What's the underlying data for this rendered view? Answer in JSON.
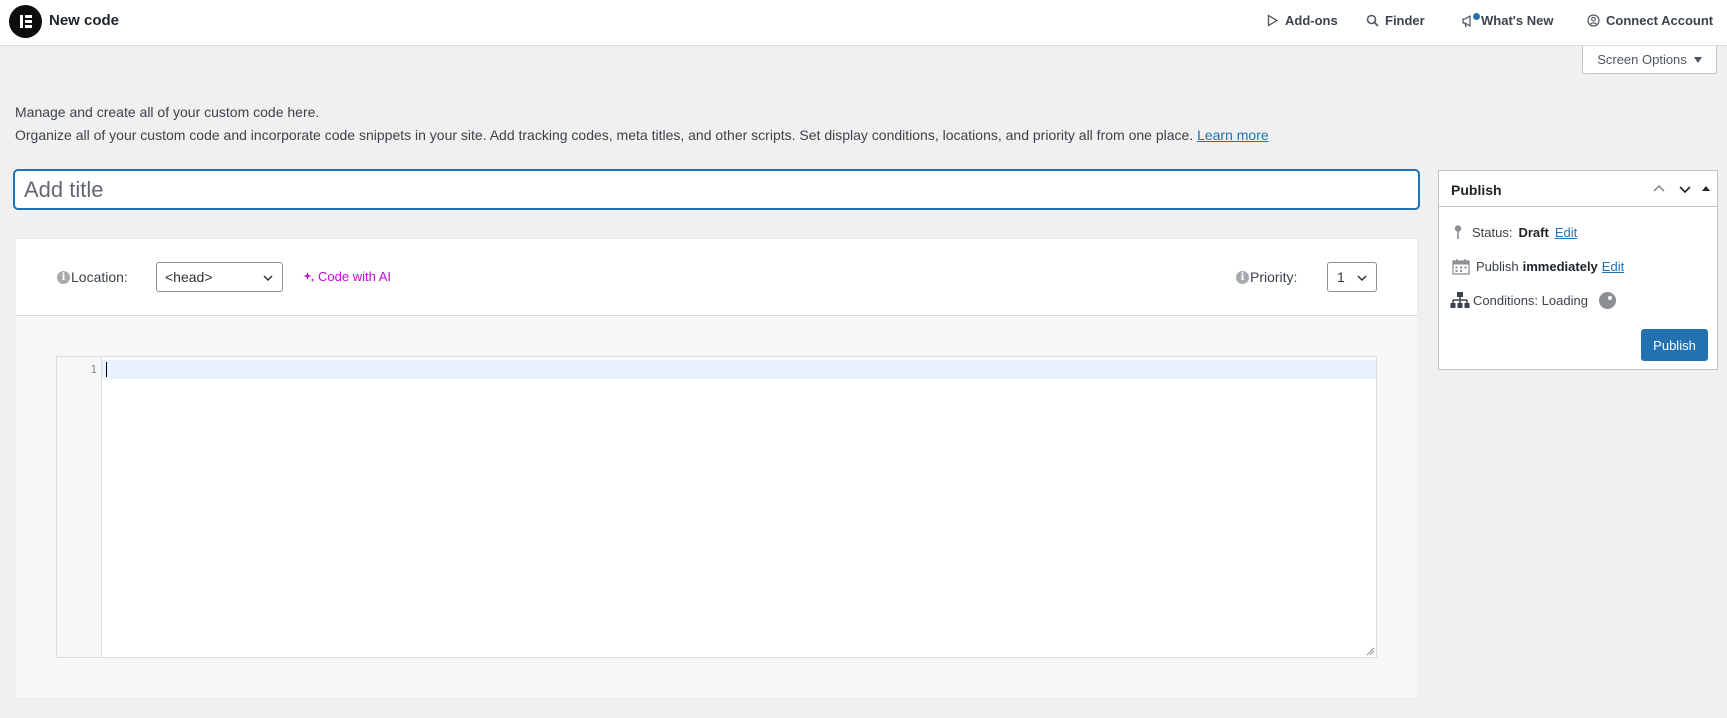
{
  "header": {
    "title": "New code",
    "links": {
      "addons": "Add-ons",
      "finder": "Finder",
      "whats_new": "What's New",
      "connect": "Connect Account"
    },
    "screen_options": "Screen Options"
  },
  "intro": {
    "line1": "Manage and create all of your custom code here.",
    "line2": "Organize all of your custom code and incorporate code snippets in your site. Add tracking codes, meta titles, and other scripts. Set display conditions, locations, and priority all from one place.",
    "learn_more": "Learn more"
  },
  "title_field": {
    "placeholder": "Add title",
    "value": ""
  },
  "editor": {
    "location_label": "Location:",
    "location_value": "<head>",
    "code_with_ai": "Code with AI",
    "priority_label": "Priority:",
    "priority_value": "1",
    "line_numbers": [
      "1"
    ]
  },
  "publish": {
    "title": "Publish",
    "status_label": "Status:",
    "status_value": "Draft",
    "status_edit": "Edit",
    "publish_label": "Publish",
    "publish_value": "immediately",
    "publish_edit": "Edit",
    "conditions_label": "Conditions: Loading",
    "button": "Publish"
  },
  "colors": {
    "accent": "#2271b1",
    "ai_accent": "#c00ad0",
    "background": "#f0f0f1"
  }
}
